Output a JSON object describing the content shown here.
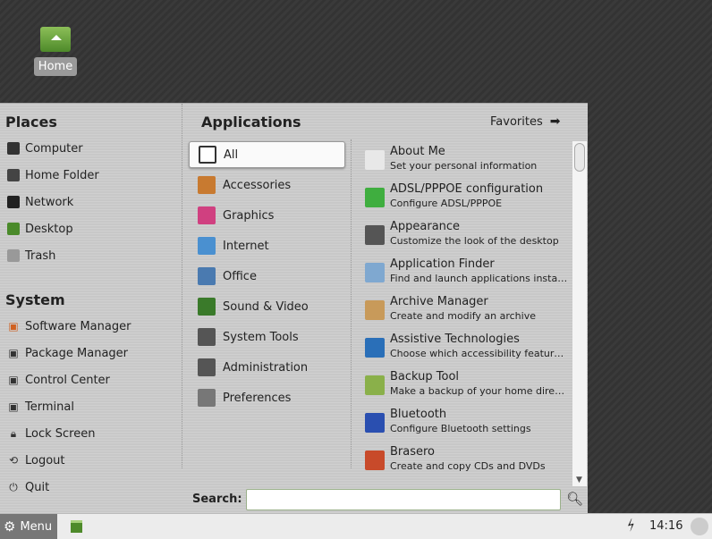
{
  "desktop": {
    "home_label": "Home"
  },
  "places": {
    "title": "Places",
    "items": [
      {
        "label": "Computer",
        "icon": "monitor-icon"
      },
      {
        "label": "Home Folder",
        "icon": "home-icon"
      },
      {
        "label": "Network",
        "icon": "network-icon"
      },
      {
        "label": "Desktop",
        "icon": "desktop-icon"
      },
      {
        "label": "Trash",
        "icon": "trash-icon"
      }
    ]
  },
  "system": {
    "title": "System",
    "items": [
      {
        "label": "Software Manager"
      },
      {
        "label": "Package Manager"
      },
      {
        "label": "Control Center"
      },
      {
        "label": "Terminal"
      },
      {
        "label": "Lock Screen"
      },
      {
        "label": "Logout"
      },
      {
        "label": "Quit"
      }
    ]
  },
  "applications": {
    "title": "Applications",
    "favorites": "Favorites",
    "categories": [
      "All",
      "Accessories",
      "Graphics",
      "Internet",
      "Office",
      "Sound & Video",
      "System Tools",
      "Administration",
      "Preferences"
    ],
    "selected_category": "All",
    "apps": [
      {
        "name": "About Me",
        "desc": "Set your personal information"
      },
      {
        "name": "ADSL/PPPOE configuration",
        "desc": "Configure ADSL/PPPOE"
      },
      {
        "name": "Appearance",
        "desc": "Customize the look of the desktop"
      },
      {
        "name": "Application Finder",
        "desc": "Find and launch applications installed..."
      },
      {
        "name": "Archive Manager",
        "desc": "Create and modify an archive"
      },
      {
        "name": "Assistive Technologies",
        "desc": "Choose which accessibility features t..."
      },
      {
        "name": "Backup Tool",
        "desc": "Make a backup of your home directory"
      },
      {
        "name": "Bluetooth",
        "desc": "Configure Bluetooth settings"
      },
      {
        "name": "Brasero",
        "desc": "Create and copy CDs and DVDs"
      }
    ]
  },
  "search": {
    "label": "Search:",
    "value": ""
  },
  "taskbar": {
    "menu_label": "Menu",
    "clock": "14:16"
  },
  "colors": {
    "icon_colors": [
      "#e8e8e8",
      "#3fae3f",
      "#555",
      "#7fa8d0",
      "#c89a5a",
      "#2a6fb8",
      "#8ab04a",
      "#2a4fb0",
      "#c84a2a"
    ],
    "cat_colors": [
      "#fff",
      "#c87a30",
      "#d04080",
      "#4a90d0",
      "#4a7ab0",
      "#3a7a2a",
      "#555",
      "#555",
      "#777"
    ]
  }
}
